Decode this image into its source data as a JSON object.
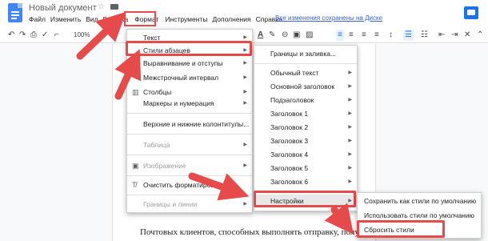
{
  "header": {
    "title": "Новый документ",
    "saved_status": "Все изменения сохранены на Диске"
  },
  "menubar": {
    "items": [
      "Файл",
      "Изменить",
      "Вид",
      "Вставка",
      "Формат",
      "Инструменты",
      "Дополнения",
      "Справка"
    ]
  },
  "toolbar": {
    "zoom": "100%"
  },
  "format_menu": {
    "items": [
      {
        "label": "Текст",
        "arrow": "▶"
      },
      {
        "label": "Стили абзацев",
        "arrow": "▶"
      },
      {
        "label": "Выравнивание и отступы",
        "arrow": "▶"
      },
      {
        "label": "Межстрочный интервал",
        "arrow": "▶"
      },
      {
        "label": "Столбцы",
        "arrow": "▶"
      },
      {
        "label": "Маркеры и нумерация",
        "arrow": "▶"
      },
      {
        "label": "Верхние и нижние колонтитулы..."
      },
      {
        "label": "Таблица",
        "arrow": "▶"
      },
      {
        "label": "Изображение",
        "arrow": "▶"
      },
      {
        "label": "Очистить форматирование"
      },
      {
        "label": "Границы и линии",
        "arrow": "▶"
      }
    ]
  },
  "styles_menu": {
    "items": [
      {
        "label": "Границы и заливка..."
      },
      {
        "label": "Обычный текст",
        "arrow": "▶"
      },
      {
        "label": "Основной заголовок",
        "arrow": "▶"
      },
      {
        "label": "Подзаголовок",
        "arrow": "▶"
      },
      {
        "label": "Заголовок 1",
        "arrow": "▶"
      },
      {
        "label": "Заголовок 2",
        "arrow": "▶"
      },
      {
        "label": "Заголовок 3",
        "arrow": "▶"
      },
      {
        "label": "Заголовок 4",
        "arrow": "▶"
      },
      {
        "label": "Заголовок 5",
        "arrow": "▶"
      },
      {
        "label": "Заголовок 6",
        "arrow": "▶"
      },
      {
        "label": "Настройки",
        "arrow": "▶"
      }
    ]
  },
  "settings_menu": {
    "items": [
      {
        "label": "Сохранить как стили по умолчанию"
      },
      {
        "label": "Использовать стили по умолчанию"
      },
      {
        "label": "Сбросить стили"
      }
    ]
  },
  "document": {
    "text": "Почтовых клиентов, способных выполнять отправку, получение п"
  },
  "colors": {
    "highlight": "#e64a4a",
    "accent": "#1a73e8"
  }
}
